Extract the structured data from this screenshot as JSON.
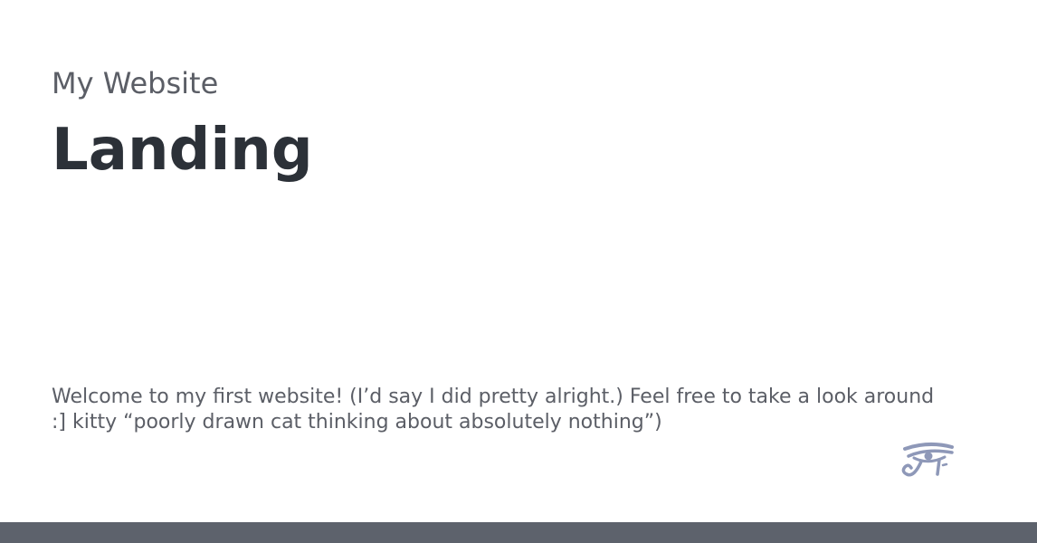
{
  "header": {
    "site_name": "My Website",
    "title": "Landing"
  },
  "intro": {
    "text": "Welcome to my first website! (I’d say I did pretty alright.) Feel free to take a look around :] kitty “poorly drawn cat thinking about absolutely nothing”)"
  },
  "eye_link": {
    "icon": "eye-of-horus-icon",
    "color": "#8e98b8"
  },
  "footer": {
    "color": "#5d626c"
  }
}
